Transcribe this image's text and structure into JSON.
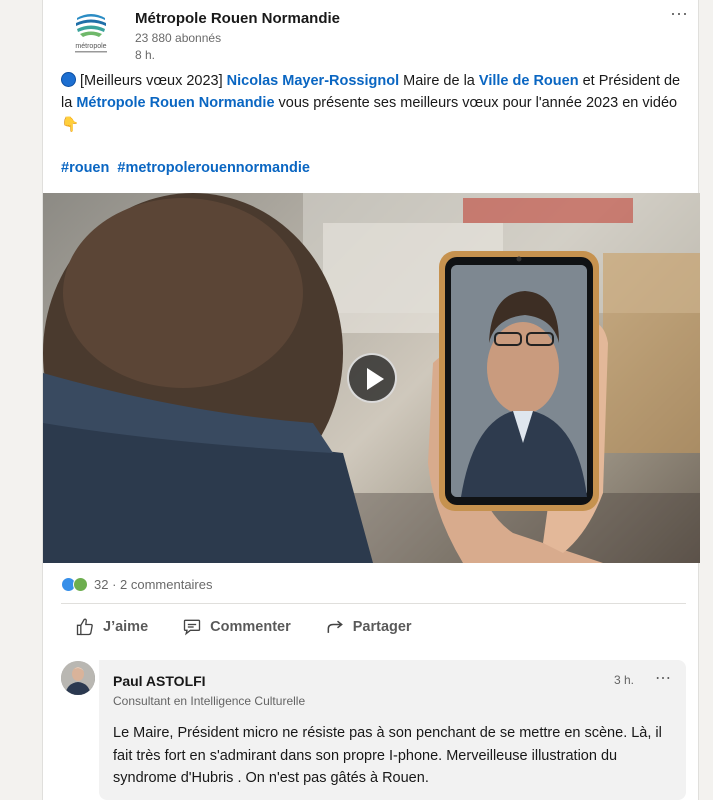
{
  "post": {
    "org_name": "Métropole Rouen Normandie",
    "logo_text": "métropole",
    "followers": "23 880  abonnés",
    "time": "8 h.",
    "more_icon": "⋯",
    "text": {
      "part1": "[Meilleurs vœux 2023] ",
      "mention1": "Nicolas Mayer-Rossignol",
      "part2": " Maire de la ",
      "mention2": "Ville de Rouen",
      "part3": "  et Président de la ",
      "mention3": "Métropole Rouen Normandie",
      "part4": "  vous présente ses meilleurs vœux pour l'année 2023 en vidéo ",
      "emoji": "👇"
    },
    "hashtags": [
      "#rouen",
      "#metropolerouennormandie"
    ],
    "accent_color": "#0a66c2"
  },
  "social": {
    "reaction_icons": [
      "like-icon",
      "celebrate-icon"
    ],
    "counts": "32 · 2 commentaires"
  },
  "actions": {
    "like": "J’aime",
    "comment": "Commenter",
    "share": "Partager"
  },
  "comment": {
    "name": "Paul ASTOLFI",
    "headline": "Consultant en Intelligence Culturelle",
    "time": "3 h.",
    "more_icon": "⋯",
    "text": "Le Maire, Président micro ne résiste pas à son penchant de se mettre en scène. Là, il fait très fort en s'admirant dans son propre I-phone. Merveilleuse illustration du syndrome d'Hubris . On n'est pas gâtés à Rouen."
  }
}
